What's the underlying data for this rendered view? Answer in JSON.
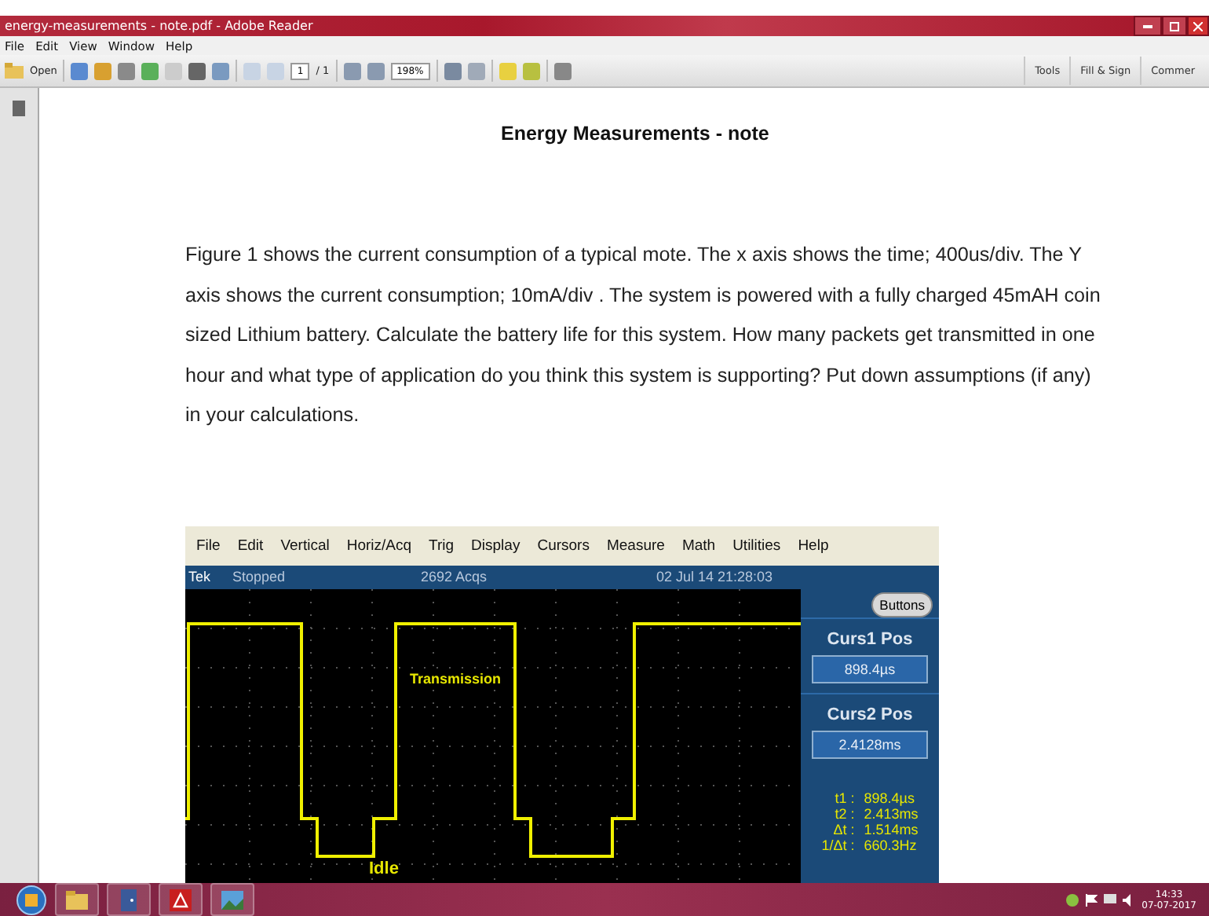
{
  "window": {
    "title": "energy-measurements - note.pdf - Adobe Reader"
  },
  "menu": [
    "File",
    "Edit",
    "View",
    "Window",
    "Help"
  ],
  "toolbar": {
    "open": "Open",
    "page": "1",
    "page_count": "/ 1",
    "zoom": "198%",
    "right_buttons": [
      "Tools",
      "Fill & Sign",
      "Commer"
    ]
  },
  "document": {
    "title": "Energy Measurements - note",
    "paragraph": "Figure 1 shows the current consumption of a typical mote.  The x axis shows the time; 400us/div. The Y axis shows the current consumption; 10mA/div .  The system is powered with a fully charged 45mAH coin sized Lithium battery. Calculate the battery life for this system.  How many packets get transmitted in one hour and what type of application do you think this system is supporting? Put down assumptions (if any) in your calculations.",
    "scope": {
      "menu": [
        "File",
        "Edit",
        "Vertical",
        "Horiz/Acq",
        "Trig",
        "Display",
        "Cursors",
        "Measure",
        "Math",
        "Utilities",
        "Help"
      ],
      "status": {
        "brand": "Tek",
        "state": "Stopped",
        "acqs": "2692 Acqs",
        "date": "02 Jul 14 21:28:03"
      },
      "labels": [
        {
          "kind": "high",
          "text": "Transmission"
        },
        {
          "kind": "low",
          "text": "Idle"
        }
      ],
      "panel": {
        "button": "Buttons",
        "cursors": [
          {
            "label": "Curs1 Pos",
            "value": "898.4µs"
          },
          {
            "label": "Curs2 Pos",
            "value": "2.4128ms"
          }
        ],
        "readouts": [
          {
            "name": "t1 :",
            "value": "898.4µs"
          },
          {
            "name": "t2 :",
            "value": "2.413ms"
          },
          {
            "name": "Δt :",
            "value": "1.514ms"
          },
          {
            "name": "1/Δt :",
            "value": "660.3Hz"
          }
        ]
      }
    }
  },
  "taskbar": {
    "time": "14:33",
    "date": "07-07-2017"
  }
}
